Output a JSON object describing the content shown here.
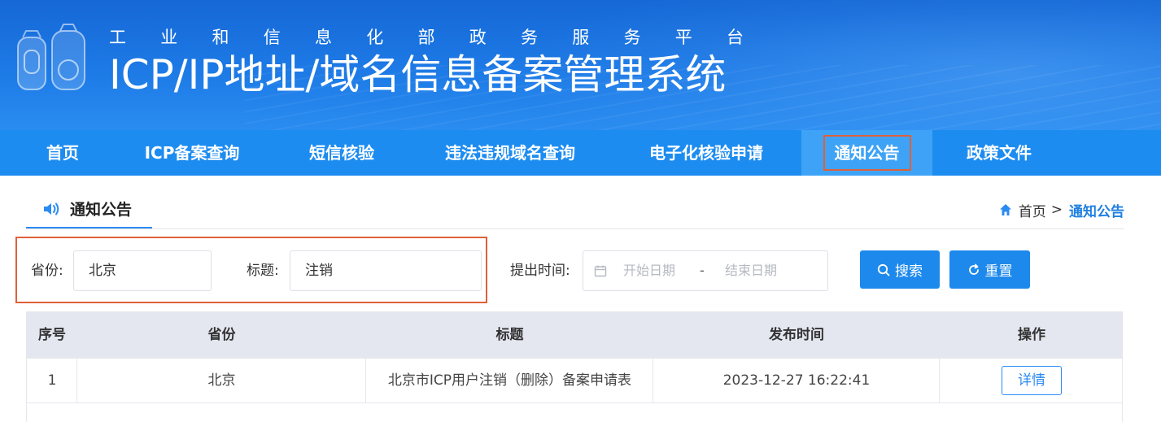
{
  "header": {
    "subtitle_chars": [
      "工",
      "业",
      "和",
      "信",
      "息",
      "化",
      "部",
      "政",
      "务",
      "服",
      "务",
      "平",
      "台"
    ],
    "title": "ICP/IP地址/域名信息备案管理系统",
    "emblem_icon": "ministry-emblem-icon"
  },
  "nav": {
    "items": [
      {
        "label": "首页"
      },
      {
        "label": "ICP备案查询"
      },
      {
        "label": "短信核验"
      },
      {
        "label": "违法违规域名查询"
      },
      {
        "label": "电子化核验申请"
      },
      {
        "label": "通知公告",
        "active": true
      },
      {
        "label": "政策文件"
      }
    ],
    "color": "#1d8cf0",
    "active_color": "#3ea3f6"
  },
  "section": {
    "icon": "speaker-icon",
    "title": "通知公告"
  },
  "breadcrumb": {
    "icon": "home-icon",
    "home": "首页",
    "separator": ">",
    "current": "通知公告"
  },
  "filters": {
    "province_label": "省份:",
    "province_value": "北京",
    "title_label": "标题:",
    "title_value": "注销",
    "time_label": "提出时间:",
    "date_icon": "calendar-icon",
    "start_placeholder": "开始日期",
    "range_separator": "-",
    "end_placeholder": "结束日期",
    "search_button": "搜索",
    "reset_button": "重置"
  },
  "table": {
    "columns": [
      "序号",
      "省份",
      "标题",
      "发布时间",
      "操作"
    ],
    "rows": [
      {
        "index": "1",
        "province": "北京",
        "title": "北京市ICP用户注销（删除）备案申请表",
        "published": "2023-12-27 16:22:41",
        "action": "详情"
      }
    ]
  },
  "colors": {
    "accent": "#1d89ec",
    "highlight_box": "#e0603a",
    "header_bg": "#e4e7f0"
  }
}
